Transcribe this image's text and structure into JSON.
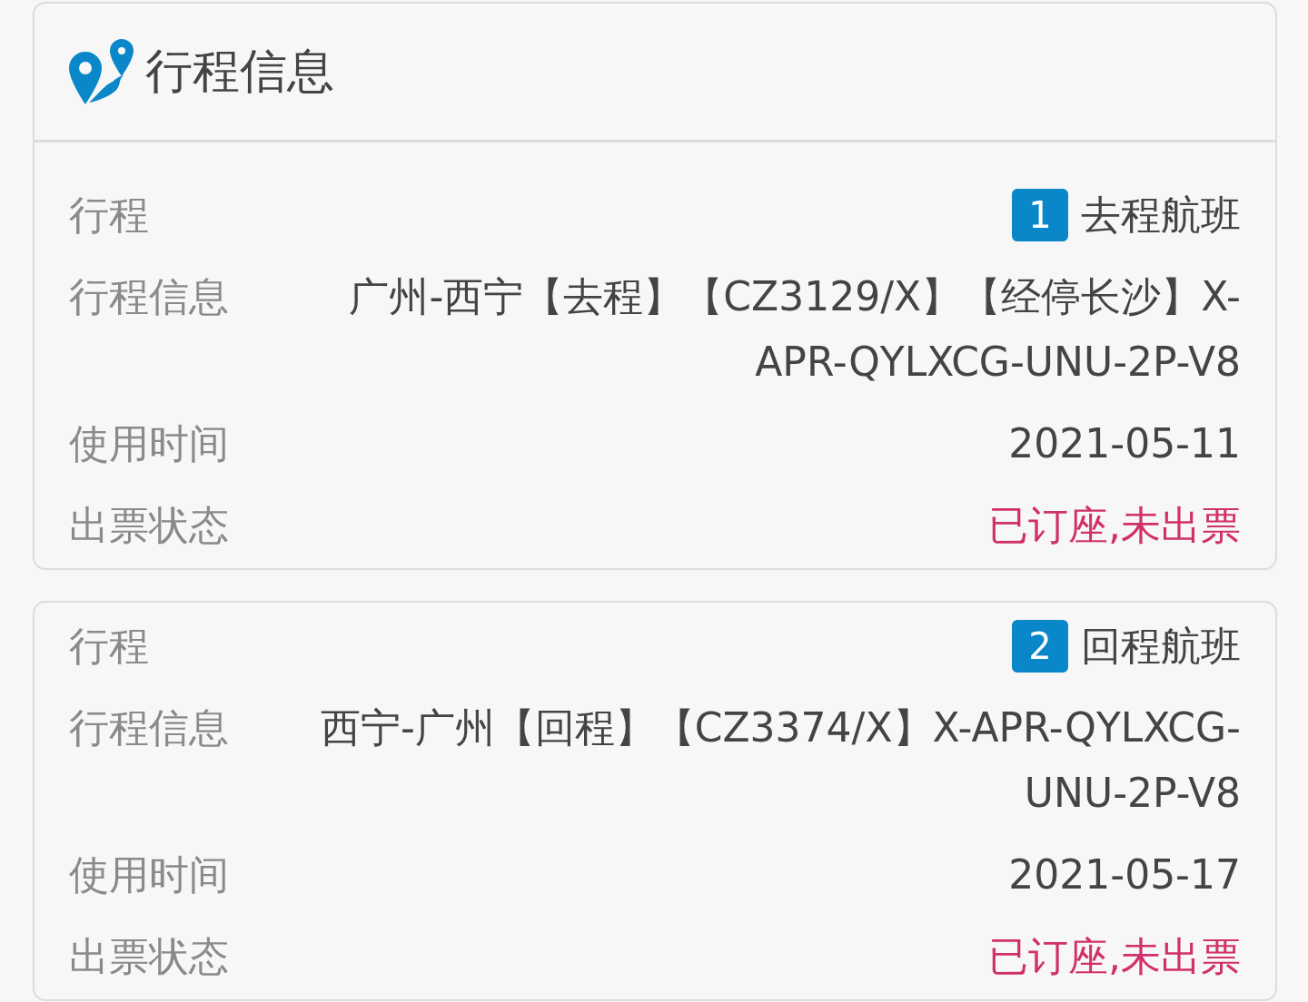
{
  "section": {
    "title": "行程信息"
  },
  "trips": [
    {
      "fields": [
        {
          "kind": "flight",
          "label": "行程",
          "number": "1",
          "value": "去程航班"
        },
        {
          "kind": "text",
          "label": "行程信息",
          "value": "广州-西宁【去程】【CZ3129/X】【经停长沙】X-APR-QYLXCG-UNU-2P-V8"
        },
        {
          "kind": "text",
          "label": "使用时间",
          "value": "2021-05-11"
        },
        {
          "kind": "status",
          "label": "出票状态",
          "value": "已订座,未出票"
        }
      ]
    },
    {
      "fields": [
        {
          "kind": "flight",
          "label": "行程",
          "number": "2",
          "value": "回程航班"
        },
        {
          "kind": "text",
          "label": "行程信息",
          "value": "西宁-广州【回程】【CZ3374/X】X-APR-QYLXCG-UNU-2P-V8"
        },
        {
          "kind": "text",
          "label": "使用时间",
          "value": "2021-05-17"
        },
        {
          "kind": "status",
          "label": "出票状态",
          "value": "已订座,未出票"
        }
      ]
    }
  ]
}
